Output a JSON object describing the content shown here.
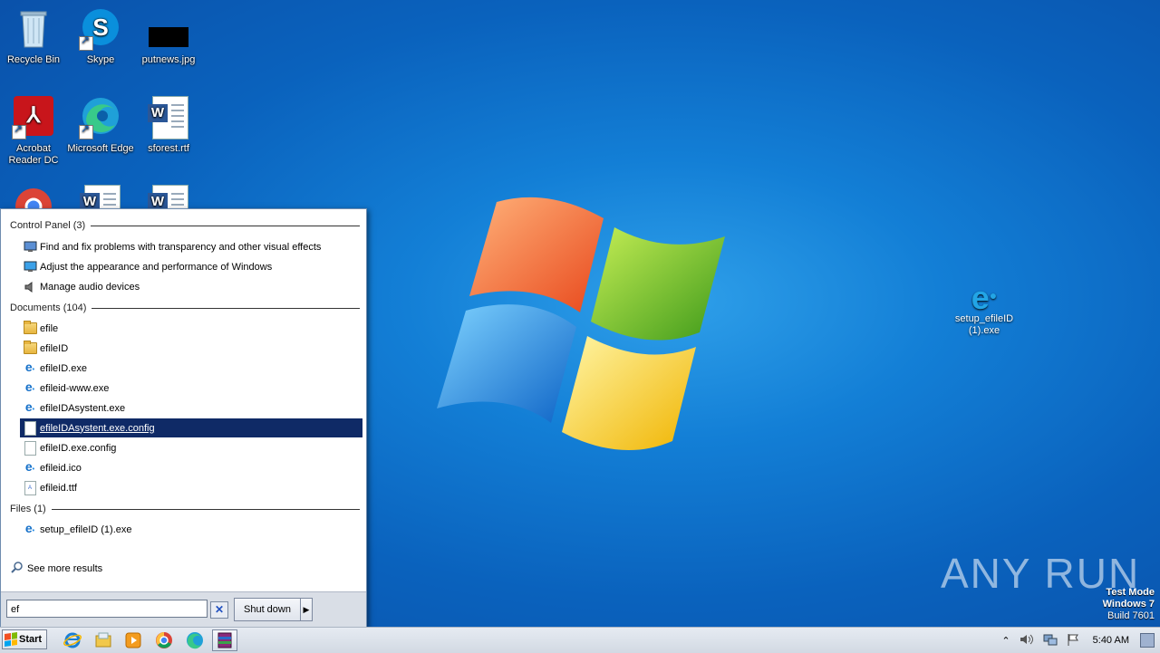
{
  "desktop": {
    "icons": [
      {
        "label": "Recycle Bin"
      },
      {
        "label": "Skype"
      },
      {
        "label": "putnews.jpg"
      },
      {
        "label": "Acrobat Reader DC"
      },
      {
        "label": "Microsoft Edge"
      },
      {
        "label": "sforest.rtf"
      }
    ],
    "right_file": {
      "label": "setup_efileID (1).exe"
    }
  },
  "start_menu": {
    "sections": {
      "control_panel": "Control Panel (3)",
      "documents": "Documents (104)",
      "files": "Files (1)"
    },
    "control_panel_items": [
      "Find and fix problems with transparency and other visual effects",
      "Adjust the appearance and performance of Windows",
      "Manage audio devices"
    ],
    "document_items": [
      "efile",
      "efileID",
      "efileID.exe",
      "efileid-www.exe",
      "efileIDAsystent.exe",
      "efileIDAsystent.exe.config",
      "efileID.exe.config",
      "efileid.ico",
      "efileid.ttf"
    ],
    "file_items": [
      "setup_efileID (1).exe"
    ],
    "see_more": "See more results",
    "search_value": "ef",
    "shutdown_label": "Shut down"
  },
  "taskbar": {
    "start_label": "Start",
    "clock": "5:40 AM"
  },
  "watermark": {
    "brand": "ANY RUN",
    "test_mode": "Test Mode",
    "os": "Windows 7",
    "build": "Build 7601"
  }
}
